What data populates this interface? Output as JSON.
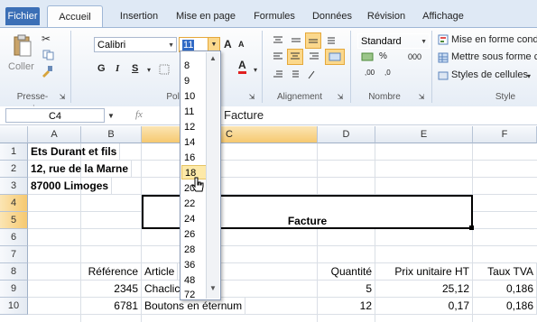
{
  "tabs": [
    "Fichier",
    "Accueil",
    "Insertion",
    "Mise en page",
    "Formules",
    "Données",
    "Révision",
    "Affichage"
  ],
  "ribbon": {
    "clipboard": {
      "paste_label": "Coller",
      "group_label": "Presse-papiers"
    },
    "font": {
      "font_name": "Calibri",
      "font_size": "11",
      "group_label": "Police",
      "bold": "G",
      "italic": "I",
      "underline": "S",
      "grow": "A",
      "shrink": "A",
      "color": "A"
    },
    "alignment": {
      "group_label": "Alignement"
    },
    "number": {
      "format": "Standard",
      "percent": "%",
      "thousands": "000",
      "group_label": "Nombre",
      "inc_dec": ",00",
      "dec_dec": ",0"
    },
    "style": {
      "cond_format": "Mise en forme cond",
      "table_format": "Mettre sous forme c",
      "cell_styles": "Styles de cellules",
      "group_label": "Style"
    }
  },
  "formula_bar": {
    "name_box": "C4",
    "fx": "fx",
    "content": "Facture"
  },
  "columns": [
    "A",
    "B",
    "C",
    "D",
    "E",
    "F"
  ],
  "rows": [
    "1",
    "2",
    "3",
    "4",
    "5",
    "6",
    "7",
    "8",
    "9",
    "10"
  ],
  "cells": {
    "A1": "Ets Durant et fils",
    "A2": "12, rue de la Marne",
    "A3": "87000 Limoges",
    "C5": "Facture",
    "B8": "Référence",
    "C8": "Article",
    "D8": "Quantité",
    "E8": "Prix unitaire HT",
    "F8": "Taux TVA",
    "B9": "2345",
    "C9": "Chaclic...risé",
    "D9": "5",
    "E9": "25,12",
    "F9": "0,186",
    "B10": "6781",
    "C10": "Boutons en éternum",
    "D10": "12",
    "E10": "0,17",
    "F10": "0,186"
  },
  "font_size_list": [
    "8",
    "9",
    "10",
    "11",
    "12",
    "14",
    "16",
    "18",
    "20",
    "22",
    "24",
    "26",
    "28",
    "36",
    "48",
    "72"
  ],
  "font_size_highlighted": "18"
}
